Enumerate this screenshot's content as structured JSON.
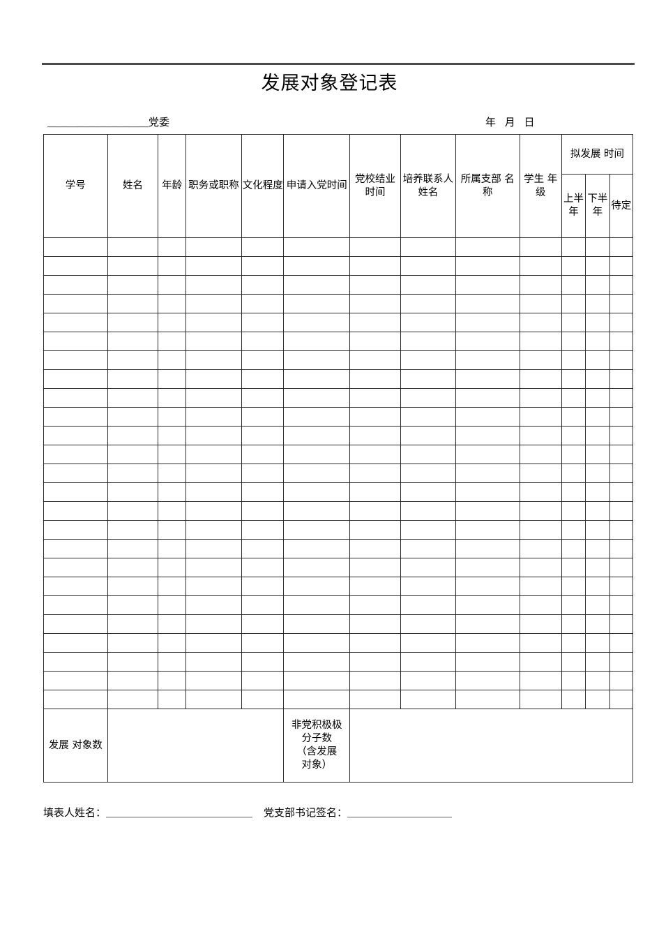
{
  "document": {
    "title": "发展对象登记表",
    "org_blank": "＿＿＿＿＿＿＿＿＿＿",
    "org_suffix": "党委",
    "date_line": "年 月 日"
  },
  "table": {
    "group_header": {
      "label": "拟发展 时间"
    },
    "columns": [
      {
        "key": "student_id",
        "label": "学号"
      },
      {
        "key": "name",
        "label": "姓名"
      },
      {
        "key": "age",
        "label": "年龄"
      },
      {
        "key": "position_title",
        "label": "职务或职称"
      },
      {
        "key": "education",
        "label": "文化程度"
      },
      {
        "key": "apply_date",
        "label": "申请入党时间"
      },
      {
        "key": "party_school_date",
        "label": "党校结业时间"
      },
      {
        "key": "mentor_name",
        "label": "培养联系人姓名"
      },
      {
        "key": "branch_name",
        "label": "所属支部 名称"
      },
      {
        "key": "student_grade",
        "label": "学生 年级"
      }
    ],
    "sub_columns": [
      {
        "key": "first_half",
        "label": "上半年"
      },
      {
        "key": "second_half",
        "label": "下半年"
      },
      {
        "key": "pending",
        "label": "待定"
      }
    ],
    "row_count": 25,
    "rows": [],
    "footer": {
      "dev_count_label": "发展 对象数",
      "dev_count_value": "",
      "non_party_label": "非党积极分子数\n（含发展对象）",
      "non_party_label_lines": [
        "非党积极极",
        "分子数",
        "（含发展",
        "对象）"
      ],
      "non_party_value": ""
    }
  },
  "signature": {
    "filler_label": "填表人姓名：",
    "filler_blank": "＿＿＿＿＿＿＿＿＿＿＿＿＿＿",
    "secretary_label": "党支部书记签名：",
    "secretary_blank": "＿＿＿＿＿＿＿＿＿＿"
  }
}
